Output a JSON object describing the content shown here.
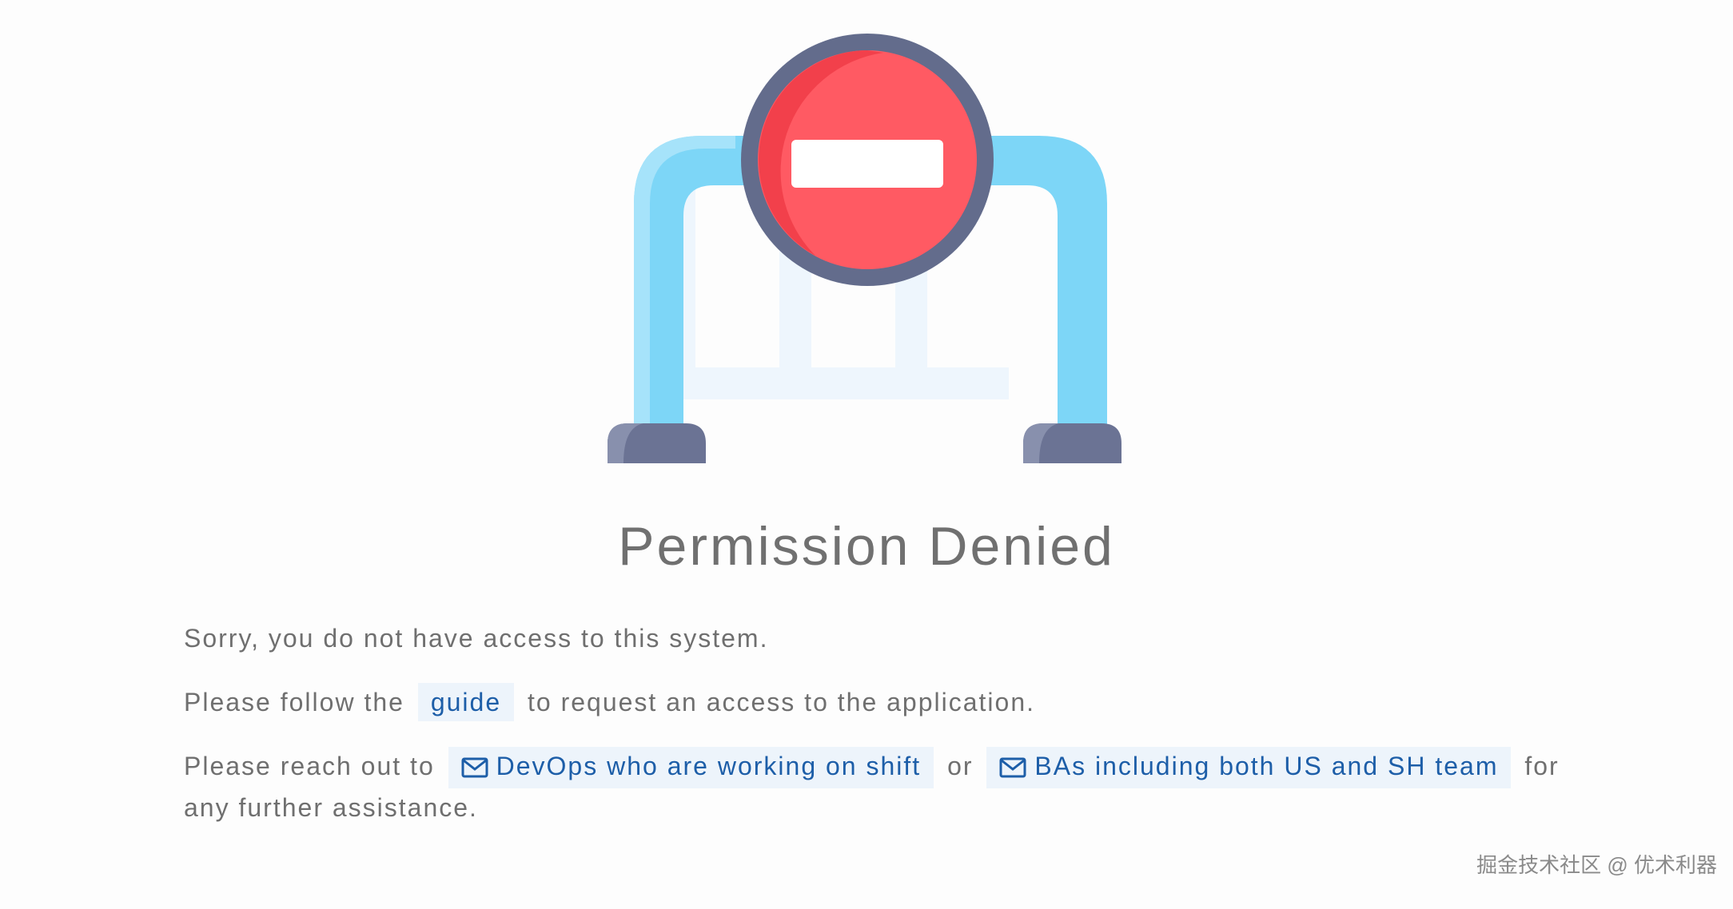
{
  "illustration": {
    "icon": "no-entry-barrier-icon",
    "colors": {
      "sign_red": "#ff5a63",
      "sign_rim": "#636c8c",
      "rail_blue": "#7dd6f7",
      "foot_grey": "#6b7394"
    }
  },
  "page": {
    "title": "Permission Denied"
  },
  "message": {
    "line1": "Sorry, you do not have access to this system.",
    "line2_prefix": "Please follow the",
    "guide_link": "guide",
    "line2_suffix": "to request an access to the application.",
    "line3_prefix": "Please reach out to",
    "devops_link": "DevOps who are working on shift",
    "or_text": "or",
    "bas_link": "BAs including both US and SH team",
    "line3_suffix": "for any further assistance."
  },
  "colors": {
    "link_text": "#1d5ea8",
    "link_bg": "#edf4fb",
    "body_text": "#6f6f6f"
  },
  "watermark": {
    "text": "掘金技术社区 @ 优术利器"
  }
}
